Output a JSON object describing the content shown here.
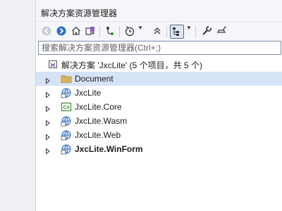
{
  "panel": {
    "title": "解决方案资源管理器"
  },
  "toolbar": {
    "icons": [
      "back-icon",
      "forward-icon",
      "home-icon",
      "switch-views-icon",
      "sync-icon",
      "pending-changes-icon",
      "collapse-all-icon",
      "show-all-files-icon",
      "properties-icon",
      "preview-icon"
    ]
  },
  "search": {
    "placeholder": "搜索解决方案资源管理器(Ctrl+;)",
    "value": ""
  },
  "solution": {
    "label": "解决方案 'JxcLite' (5 个项目，共 5 个)"
  },
  "tree": {
    "items": [
      {
        "label": "Document",
        "type": "folder",
        "selected": true,
        "bold": false
      },
      {
        "label": "JxcLite",
        "type": "web-project",
        "selected": false,
        "bold": false
      },
      {
        "label": "JxcLite.Core",
        "type": "csharp-project",
        "selected": false,
        "bold": false
      },
      {
        "label": "JxcLite.Wasm",
        "type": "web-project",
        "selected": false,
        "bold": false
      },
      {
        "label": "JxcLite.Web",
        "type": "web-project",
        "selected": false,
        "bold": false
      },
      {
        "label": "JxcLite.WinForm",
        "type": "web-project",
        "selected": false,
        "bold": true
      }
    ]
  },
  "colors": {
    "selection": "#d6e3f7",
    "accent": "#3f78c5",
    "folder": "#d6b25e",
    "csharp": "#3a8a2f"
  }
}
